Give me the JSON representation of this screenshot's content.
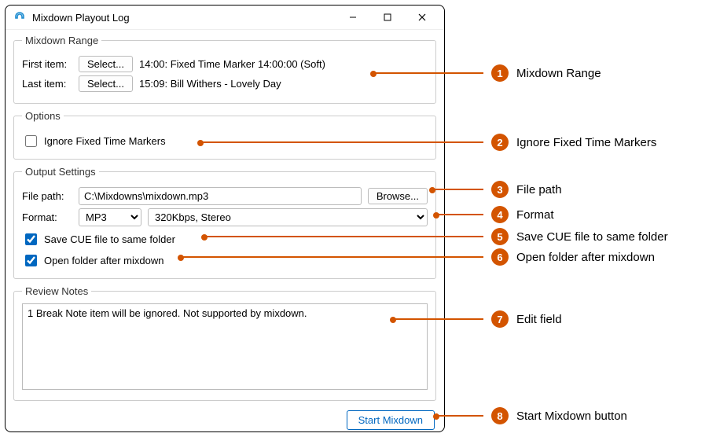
{
  "window": {
    "title": "Mixdown Playout Log"
  },
  "mixdown_range": {
    "legend": "Mixdown Range",
    "first_label": "First item:",
    "last_label": "Last item:",
    "select_button": "Select...",
    "first_value": "14:00: Fixed Time Marker 14:00:00 (Soft)",
    "last_value": "15:09: Bill Withers - Lovely Day"
  },
  "options": {
    "legend": "Options",
    "ignore_ftm_label": "Ignore Fixed Time Markers",
    "ignore_ftm_checked": false
  },
  "output": {
    "legend": "Output Settings",
    "file_path_label": "File path:",
    "file_path_value": "C:\\Mixdowns\\mixdown.mp3",
    "browse_label": "Browse...",
    "format_label": "Format:",
    "format_value": "MP3",
    "quality_value": "320Kbps, Stereo",
    "save_cue_label": "Save CUE file to same folder",
    "save_cue_checked": true,
    "open_folder_label": "Open folder after mixdown",
    "open_folder_checked": true
  },
  "review": {
    "legend": "Review Notes",
    "text": "1 Break Note item will be ignored. Not supported by mixdown."
  },
  "footer": {
    "start_label": "Start Mixdown"
  },
  "annotations": [
    {
      "n": "1",
      "label": "Mixdown Range"
    },
    {
      "n": "2",
      "label": "Ignore Fixed Time Markers"
    },
    {
      "n": "3",
      "label": "File path"
    },
    {
      "n": "4",
      "label": "Format"
    },
    {
      "n": "5",
      "label": "Save CUE file to same folder"
    },
    {
      "n": "6",
      "label": "Open folder after mixdown"
    },
    {
      "n": "7",
      "label": "Edit field"
    },
    {
      "n": "8",
      "label": "Start Mixdown button"
    }
  ]
}
